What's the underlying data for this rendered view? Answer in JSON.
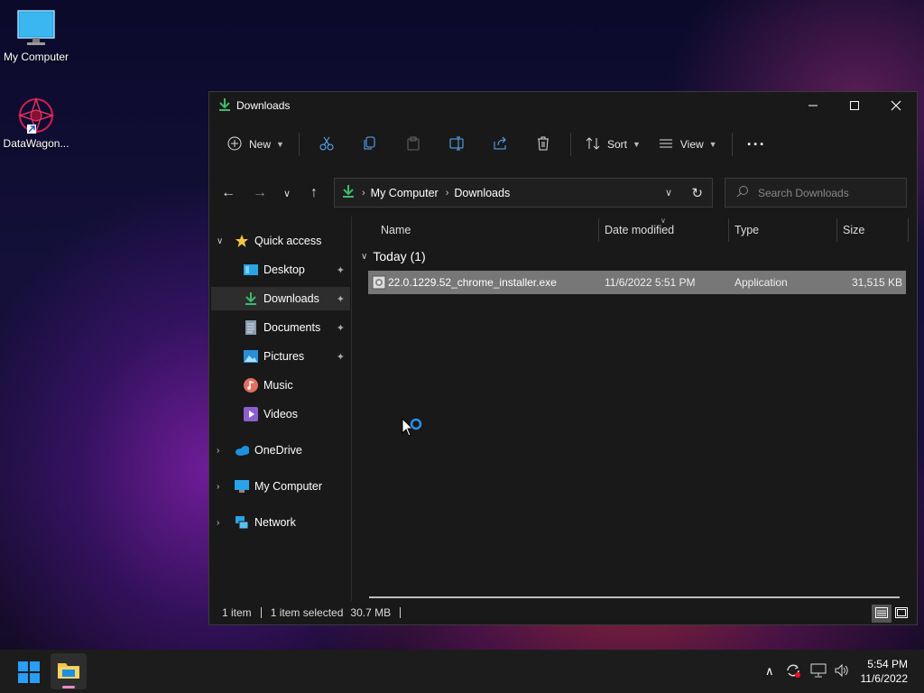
{
  "desktop": {
    "icons": [
      {
        "label": "My Computer"
      },
      {
        "label": "DataWagon..."
      }
    ]
  },
  "window": {
    "title": "Downloads",
    "controls": {
      "minimize": "—",
      "maximize": "☐",
      "close": "✕"
    }
  },
  "toolbar": {
    "new_label": "New",
    "sort_label": "Sort",
    "view_label": "View",
    "more_label": "···"
  },
  "address": {
    "crumbs": [
      "My Computer",
      "Downloads"
    ],
    "search_placeholder": "Search Downloads"
  },
  "sidebar": {
    "quick_access": "Quick access",
    "items": [
      {
        "label": "Desktop",
        "pinned": true
      },
      {
        "label": "Downloads",
        "pinned": true,
        "selected": true
      },
      {
        "label": "Documents",
        "pinned": true
      },
      {
        "label": "Pictures",
        "pinned": true
      },
      {
        "label": "Music",
        "pinned": false
      },
      {
        "label": "Videos",
        "pinned": false
      }
    ],
    "roots": [
      {
        "label": "OneDrive"
      },
      {
        "label": "My Computer"
      },
      {
        "label": "Network"
      }
    ]
  },
  "columns": {
    "name": "Name",
    "date": "Date modified",
    "type": "Type",
    "size": "Size"
  },
  "group": {
    "label": "Today (1)"
  },
  "files": [
    {
      "name": "22.0.1229.52_chrome_installer.exe",
      "date": "11/6/2022 5:51 PM",
      "type": "Application",
      "size": "31,515 KB"
    }
  ],
  "status": {
    "count": "1 item",
    "selected": "1 item selected",
    "size": "30.7 MB"
  },
  "clock": {
    "time": "5:54 PM",
    "date": "11/6/2022"
  },
  "colors": {
    "accent": "#0078d4",
    "selected_row": "#777777",
    "folder_yellow": "#f4c542",
    "download_green": "#3dbb6c"
  }
}
